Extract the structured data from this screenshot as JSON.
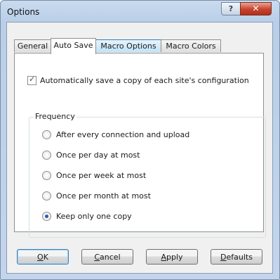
{
  "window": {
    "title": "Options",
    "help_label": "?",
    "close_label": "✕"
  },
  "tabs": [
    {
      "label": "General",
      "active": false
    },
    {
      "label": "Auto Save",
      "active": true
    },
    {
      "label": "Macro Options",
      "active": false
    },
    {
      "label": "Macro Colors",
      "active": false
    }
  ],
  "autosave": {
    "checkbox_label": "Automatically save a copy of each site's configuration",
    "checked": true
  },
  "frequency": {
    "group_label": "Frequency",
    "options": [
      {
        "label": "After every connection and upload",
        "selected": false
      },
      {
        "label": "Once per day at most",
        "selected": false
      },
      {
        "label": "Once per week at most",
        "selected": false
      },
      {
        "label": "Once per month at most",
        "selected": false
      },
      {
        "label": "Keep only one copy",
        "selected": true
      }
    ]
  },
  "buttons": {
    "ok": {
      "access": "O",
      "rest": "K"
    },
    "cancel": {
      "access": "C",
      "rest": "ancel"
    },
    "apply": {
      "access": "A",
      "rest": "pply"
    },
    "defaults": {
      "access": "D",
      "rest": "efaults"
    }
  }
}
